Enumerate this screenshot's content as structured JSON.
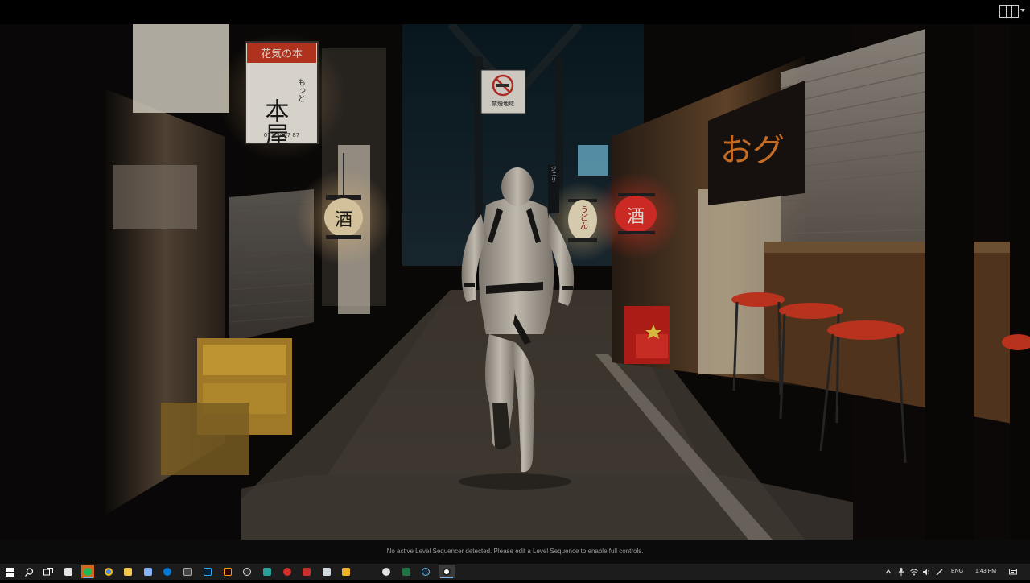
{
  "app": {
    "viewport_status_message": "No active Level Sequencer detected. Please edit a Level Sequence to enable full controls."
  },
  "scene": {
    "signs": {
      "hanging_sign_top": "花気の本",
      "hanging_sign_main": "本屋",
      "hanging_sign_side": "もっと",
      "hanging_sign_phone": "071 5467 87",
      "left_lantern": "酒",
      "center_lantern": "うどん",
      "red_lantern": "酒",
      "right_banner": "おグ",
      "no_smoking_caption": "禁煙地域",
      "vertical_sign": "ジェリ"
    }
  },
  "taskbar": {
    "icons": [
      "windows-start-icon",
      "search-icon",
      "task-view-icon",
      "store-icon",
      "spotify-icon",
      "chrome-icon",
      "file-explorer-icon",
      "notepad-icon",
      "edge-icon",
      "terminal-icon",
      "photoshop-icon",
      "illustrator-icon",
      "obs-icon",
      "app-3-icon",
      "app-red-icon",
      "app-red2-icon",
      "maps-icon",
      "m-app-icon",
      "app-chat-icon",
      "excel-icon",
      "steam-icon",
      "unreal-engine-icon"
    ],
    "active_icon": "unreal-engine-icon",
    "tray": {
      "language": "ENG",
      "time": "1:43 PM"
    },
    "colors": {
      "spotify": "#1db954",
      "chrome": "#4285f4",
      "explorer": "#f2c94c",
      "edge": "#0078d4",
      "photoshop": "#31a8ff",
      "illustrator": "#ff9a00",
      "excel": "#217346",
      "accent": "#7fb2e6"
    }
  }
}
